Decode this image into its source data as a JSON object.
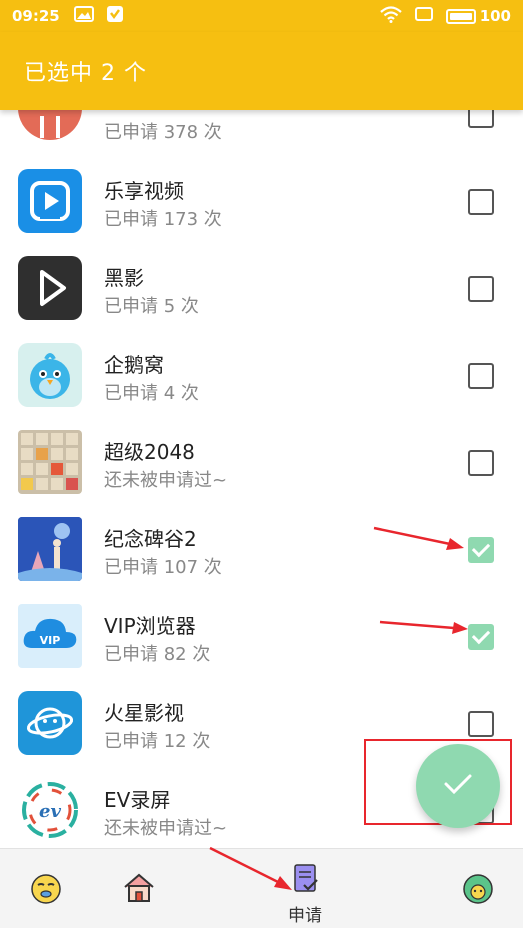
{
  "status_bar": {
    "time": "09:25",
    "battery": "100"
  },
  "header": {
    "title": "已选中 2 个"
  },
  "apps": [
    {
      "name": "",
      "status": "已申请 378 次",
      "checked": false,
      "icon": "partial-red-app-icon",
      "color": "#e36b57"
    },
    {
      "name": "乐享视频",
      "status": "已申请 173 次",
      "checked": false,
      "icon": "play-video-icon",
      "color": "#1a8fe6"
    },
    {
      "name": "黑影",
      "status": "已申请 5 次",
      "checked": false,
      "icon": "play-triangle-icon",
      "color": "#2f2f2f"
    },
    {
      "name": "企鹅窝",
      "status": "已申请 4 次",
      "checked": false,
      "icon": "blue-bird-icon",
      "color": "#3bb5e8"
    },
    {
      "name": "超级2048",
      "status": "还未被申请过~",
      "checked": false,
      "icon": "puzzle-grid-icon",
      "color": "#c9b89a"
    },
    {
      "name": "纪念碑谷2",
      "status": "已申请 107 次",
      "checked": true,
      "icon": "monument-valley-icon",
      "color": "#2b55b8"
    },
    {
      "name": "VIP浏览器",
      "status": "已申请 82 次",
      "checked": true,
      "icon": "vip-cloud-icon",
      "color": "#1f8de0"
    },
    {
      "name": "火星影视",
      "status": "已申请 12 次",
      "checked": false,
      "icon": "planet-icon",
      "color": "#1f95d9"
    },
    {
      "name": "EV录屏",
      "status": "还未被申请过~",
      "checked": false,
      "icon": "ev-logo-icon",
      "color": "#2ab0a0"
    }
  ],
  "bottom_nav": {
    "items": [
      {
        "icon": "emoji-face-icon",
        "label": ""
      },
      {
        "icon": "home-icon",
        "label": ""
      },
      {
        "icon": "apply-clipboard-icon",
        "label": "申请"
      },
      {
        "icon": "profile-face-icon",
        "label": ""
      }
    ]
  },
  "colors": {
    "accent": "#f6bf11",
    "check": "#8fd9b0",
    "annotation": "#e8262d"
  }
}
